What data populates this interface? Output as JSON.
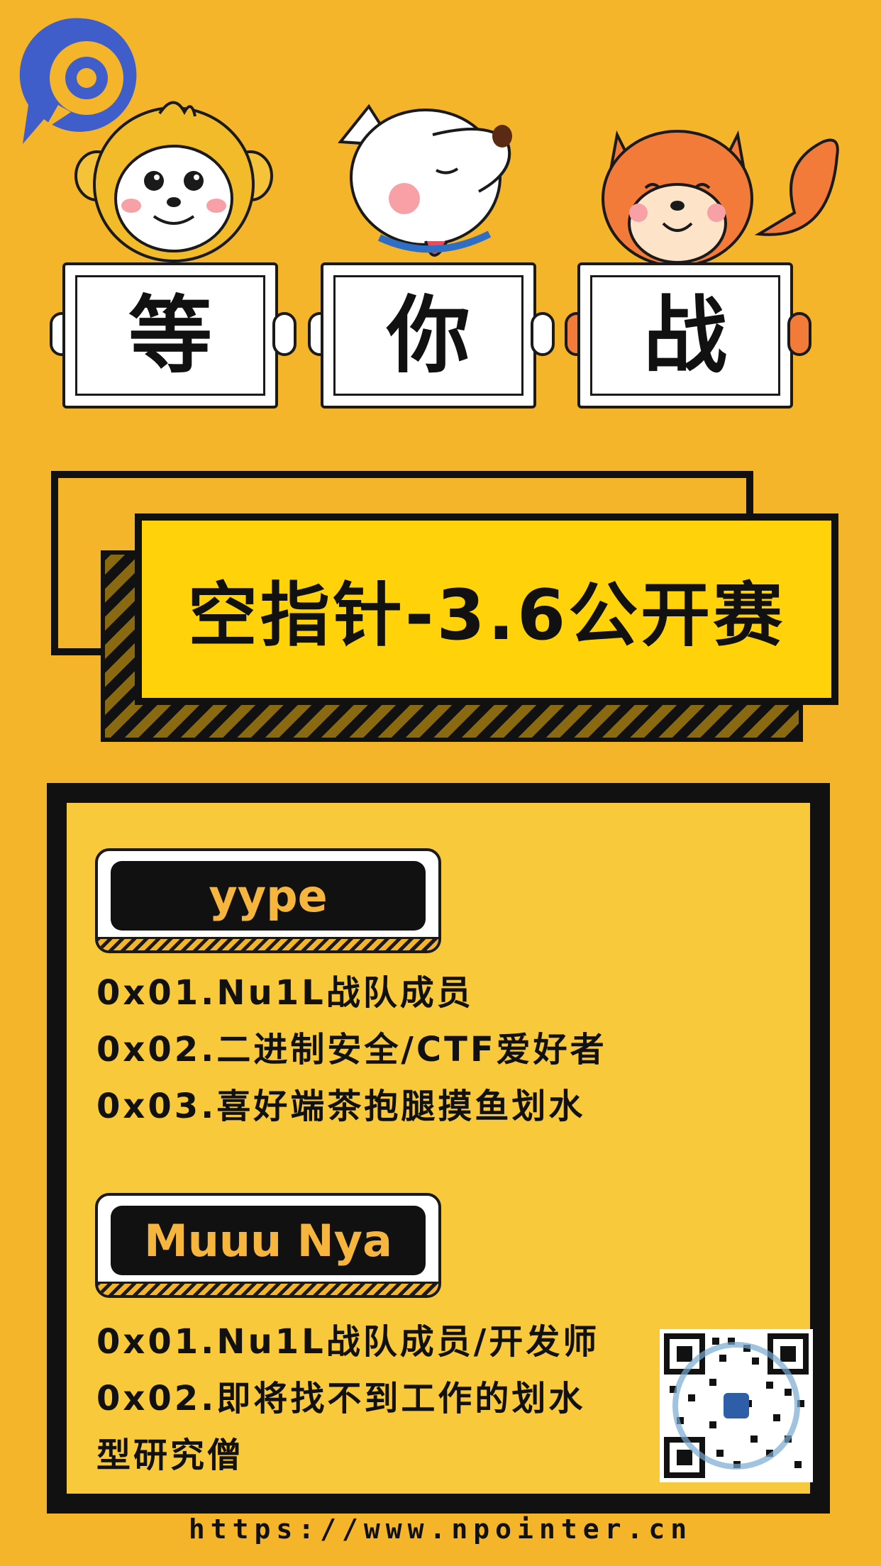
{
  "signs": [
    {
      "char": "等"
    },
    {
      "char": "你"
    },
    {
      "char": "战"
    }
  ],
  "banner": {
    "title": "空指针-3.6公开赛"
  },
  "profiles": [
    {
      "name": "yype",
      "lines": [
        "0x01.Nu1L战队成员",
        "0x02.二进制安全/CTF爱好者",
        "0x03.喜好端茶抱腿摸鱼划水"
      ]
    },
    {
      "name": "Muuu Nya",
      "lines": [
        "0x01.Nu1L战队成员/开发师",
        "0x02.即将找不到工作的划水",
        "型研究僧"
      ]
    }
  ],
  "footer": {
    "url": "https://www.npointer.cn"
  },
  "colors": {
    "background": "#f5b52a",
    "banner": "#ffd20a",
    "panel": "#f8c93a",
    "tag_text": "#f6b53c"
  },
  "icons": {
    "logo": "npointer-logo-icon",
    "qr": "qr-code-icon"
  }
}
